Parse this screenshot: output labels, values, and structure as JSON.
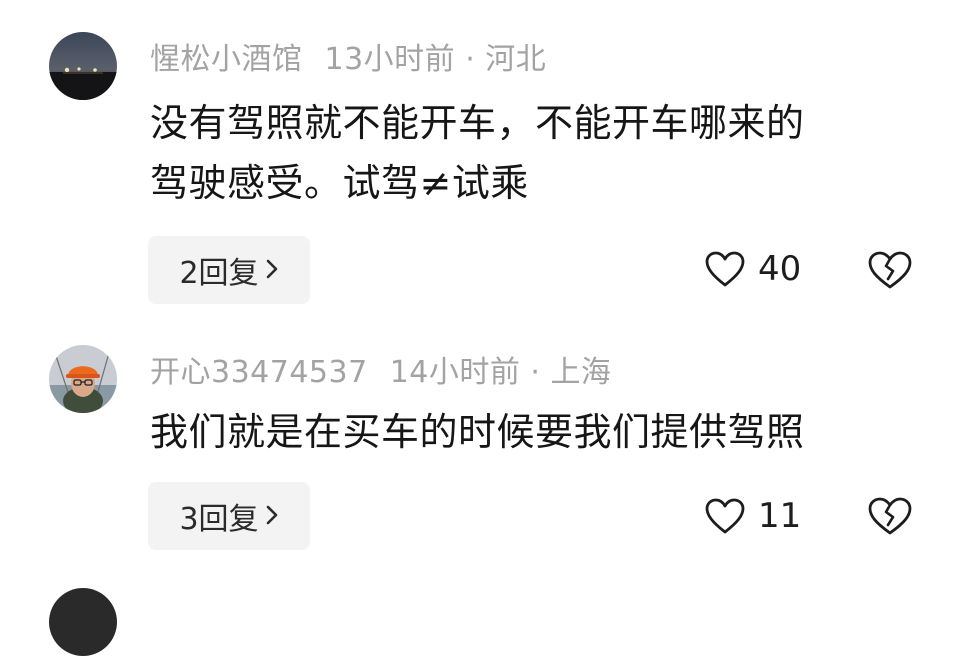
{
  "comments": [
    {
      "username": "惺松小酒馆",
      "time": "13小时前",
      "location": "河北",
      "text_line1": "没有驾照就不能开车，不能开车哪来的",
      "text_line2": "驾驶感受。试驾≠试乘",
      "replies_label": "2回复",
      "likes": "40"
    },
    {
      "username": "开心33474537",
      "time": "14小时前",
      "location": "上海",
      "text_line1": "我们就是在买车的时候要我们提供驾照",
      "replies_label": "3回复",
      "likes": "11"
    }
  ],
  "icons": {
    "like": "heart-outline-icon",
    "dislike": "broken-heart-icon",
    "reply_chevron": "chevron-right-icon"
  },
  "colors": {
    "meta_text": "#a3a3a3",
    "body_text": "#161616",
    "reply_bg": "#f3f3f3"
  }
}
